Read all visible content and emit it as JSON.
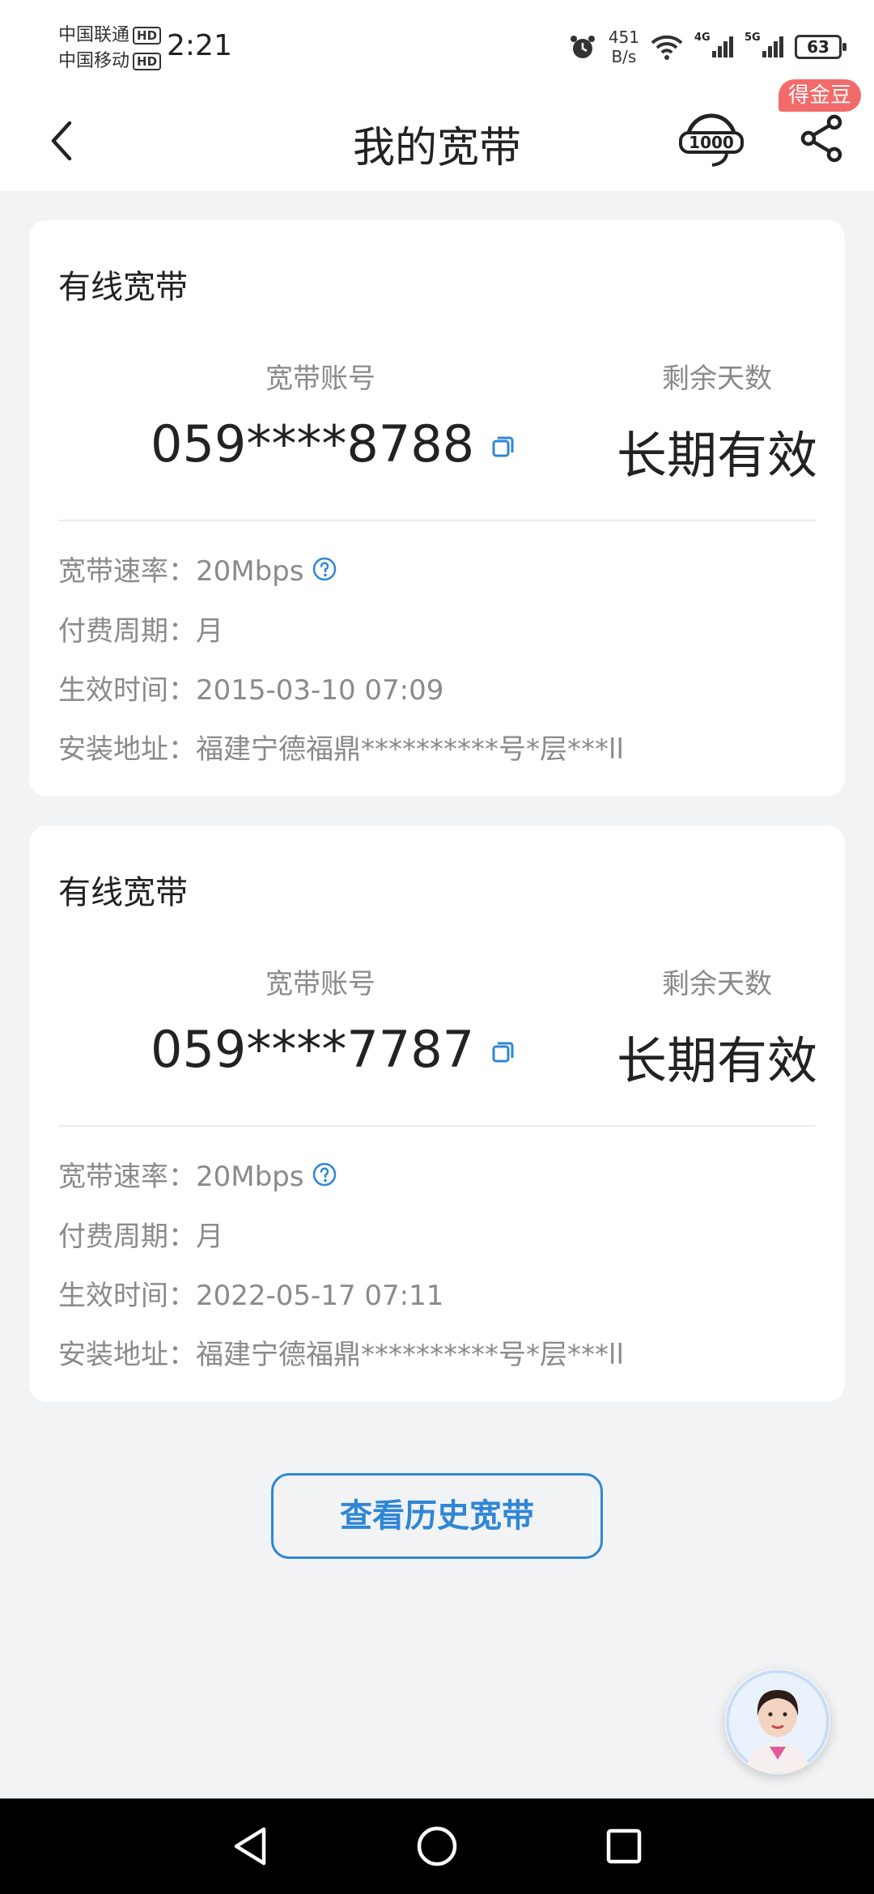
{
  "status_bar": {
    "carrier_1": "中国联通",
    "carrier_2": "中国移动",
    "hd_label": "HD",
    "time": "2:21",
    "net_speed_value": "451",
    "net_speed_unit": "B/s",
    "signal_1_tag": "4G",
    "signal_2_tag": "5G",
    "battery": "63"
  },
  "header": {
    "title": "我的宽带",
    "badge": "得金豆",
    "back_icon": "chevron-left-icon",
    "service_icon": "10000-service-icon",
    "share_icon": "share-icon"
  },
  "broadband": [
    {
      "card_title": "有线宽带",
      "account_label": "宽带账号",
      "account": "059****8788",
      "days_label": "剩余天数",
      "days": "长期有效",
      "speed": "宽带速率：20Mbps",
      "cycle": "付费周期：月",
      "effective": "生效时间：2015-03-10 07:09",
      "address": "安装地址：福建宁德福鼎**********号*层***ll"
    },
    {
      "card_title": "有线宽带",
      "account_label": "宽带账号",
      "account": "059****7787",
      "days_label": "剩余天数",
      "days": "长期有效",
      "speed": "宽带速率：20Mbps",
      "cycle": "付费周期：月",
      "effective": "生效时间：2022-05-17 07:11",
      "address": "安装地址：福建宁德福鼎**********号*层***ll"
    }
  ],
  "history_button": "查看历史宽带",
  "colors": {
    "accent": "#2f86d6",
    "badge": "#f26a6a",
    "background": "#f2f3f5"
  }
}
